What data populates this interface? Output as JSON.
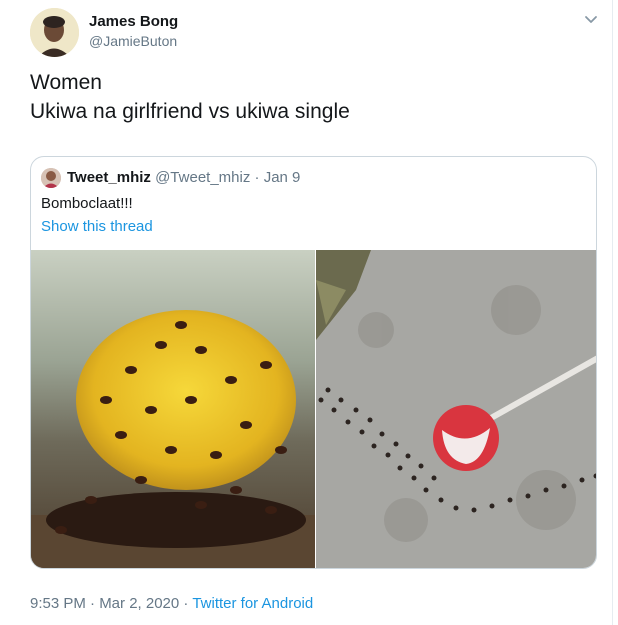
{
  "author": {
    "name": "James Bong",
    "handle": "@JamieButon"
  },
  "tweet": {
    "lines": [
      "Women",
      "Ukiwa na girlfriend vs ukiwa single"
    ]
  },
  "quoted_tweet": {
    "name": "Tweet_mhiz",
    "handle": "@Tweet_mhiz",
    "separator": "·",
    "date": "Jan 9",
    "text": "Bomboclaat!!!",
    "thread_link": "Show this thread"
  },
  "footer": {
    "time": "9:53 PM · Mar 2, 2020",
    "separator": "·",
    "source": "Twitter for Android"
  },
  "icons": {
    "menu": "chevron-down-icon"
  },
  "colors": {
    "link": "#1b95e0",
    "secondary_text": "#657786",
    "border": "#ccd6dd"
  }
}
